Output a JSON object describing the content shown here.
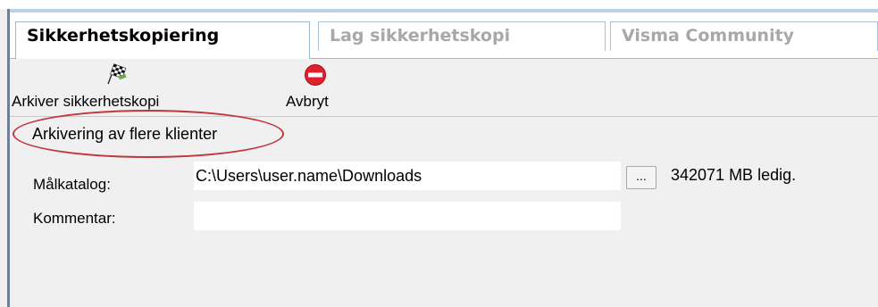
{
  "tabs": [
    {
      "label": "Sikkerhetskopiering",
      "active": true
    },
    {
      "label": "Lag sikkerhetskopi",
      "active": false
    },
    {
      "label": "Visma Community",
      "active": false
    }
  ],
  "toolbar": {
    "archive_label": "Arkiver sikkerhetskopi",
    "archive_icon": "checkered-flag-icon",
    "cancel_label": "Avbryt",
    "cancel_icon": "no-entry-icon"
  },
  "section": {
    "title": "Arkivering av flere klienter",
    "highlight_color": "#c0363a"
  },
  "form": {
    "target_dir_label": "Målkatalog:",
    "target_dir_value": "C:\\Users\\user.name\\Downloads",
    "browse_label": "...",
    "free_space": "342071 MB ledig.",
    "comment_label": "Kommentar:",
    "comment_value": ""
  },
  "colors": {
    "tab_border": "#9db4d3",
    "window_bg": "#f0f0f0",
    "cancel_red": "#e0202a"
  }
}
